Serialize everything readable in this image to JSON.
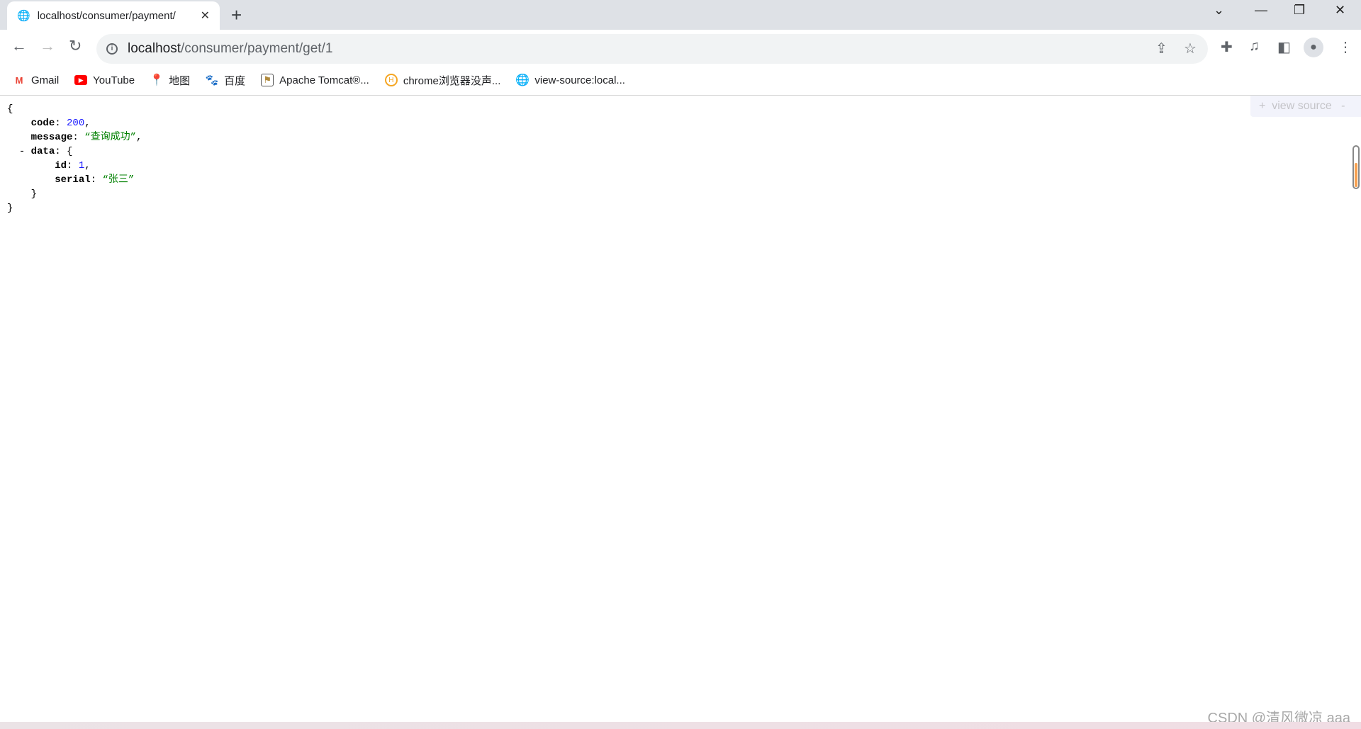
{
  "tab": {
    "title": "localhost/consumer/payment/",
    "icon": "globe-icon"
  },
  "address": {
    "host": "localhost",
    "path": "/consumer/payment/get/1"
  },
  "bookmarks": [
    {
      "label": "Gmail",
      "icon": "gmail-icon",
      "color": "#ea4335"
    },
    {
      "label": "YouTube",
      "icon": "youtube-icon",
      "color": "#ff0000"
    },
    {
      "label": "地图",
      "icon": "maps-icon",
      "color": "#34a853"
    },
    {
      "label": "百度",
      "icon": "baidu-icon",
      "color": "#2932e1"
    },
    {
      "label": "Apache Tomcat®...",
      "icon": "tomcat-icon",
      "color": "#b08a3e"
    },
    {
      "label": "chrome浏览器没声...",
      "icon": "site-icon",
      "color": "#f5a623"
    },
    {
      "label": "view-source:local...",
      "icon": "globe-icon",
      "color": "#5f6368"
    }
  ],
  "json": {
    "open": "{",
    "close": "}",
    "code_key": "code",
    "code_val": "200",
    "message_key": "message",
    "message_val": "“查询成功”",
    "data_toggle": "-",
    "data_key": "data",
    "data_open": "{",
    "data_close": "}",
    "id_key": "id",
    "id_val": "1",
    "serial_key": "serial",
    "serial_val": "“张三”"
  },
  "viewsource": {
    "plus": "+",
    "label": "view source",
    "minus": "-"
  },
  "watermark": "CSDN @清风微凉 aaa"
}
